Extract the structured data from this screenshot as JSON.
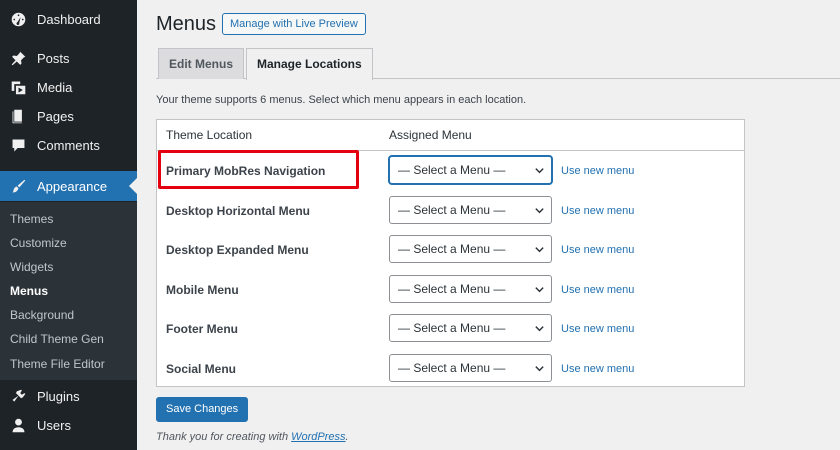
{
  "sidebar": {
    "items": [
      {
        "label": "Dashboard",
        "icon": "dashboard-icon"
      },
      {
        "label": "Posts",
        "icon": "pin-icon"
      },
      {
        "label": "Media",
        "icon": "media-icon"
      },
      {
        "label": "Pages",
        "icon": "pages-icon"
      },
      {
        "label": "Comments",
        "icon": "comments-icon"
      },
      {
        "label": "Appearance",
        "icon": "brush-icon"
      },
      {
        "label": "Plugins",
        "icon": "plugins-icon"
      },
      {
        "label": "Users",
        "icon": "users-icon"
      }
    ],
    "appearance_submenu": [
      "Themes",
      "Customize",
      "Widgets",
      "Menus",
      "Background",
      "Child Theme Gen",
      "Theme File Editor"
    ],
    "current_submenu": "Menus"
  },
  "header": {
    "title": "Menus",
    "preview_button": "Manage with Live Preview"
  },
  "tabs": [
    {
      "label": "Edit Menus",
      "active": false
    },
    {
      "label": "Manage Locations",
      "active": true
    }
  ],
  "intro": "Your theme supports 6 menus. Select which menu appears in each location.",
  "table": {
    "headers": [
      "Theme Location",
      "Assigned Menu"
    ],
    "rows": [
      {
        "location": "Primary MobRes Navigation",
        "selected": "— Select a Menu —",
        "link": "Use new menu"
      },
      {
        "location": "Desktop Horizontal Menu",
        "selected": "— Select a Menu —",
        "link": "Use new menu"
      },
      {
        "location": "Desktop Expanded Menu",
        "selected": "— Select a Menu —",
        "link": "Use new menu"
      },
      {
        "location": "Mobile Menu",
        "selected": "— Select a Menu —",
        "link": "Use new menu"
      },
      {
        "location": "Footer Menu",
        "selected": "— Select a Menu —",
        "link": "Use new menu"
      },
      {
        "location": "Social Menu",
        "selected": "— Select a Menu —",
        "link": "Use new menu"
      }
    ]
  },
  "save_button": "Save Changes",
  "footer": {
    "prefix": "Thank you for creating with ",
    "link": "WordPress",
    "suffix": "."
  },
  "colors": {
    "sidebar_bg": "#1d2327",
    "accent": "#2271b1",
    "highlight": "#e4000f"
  }
}
